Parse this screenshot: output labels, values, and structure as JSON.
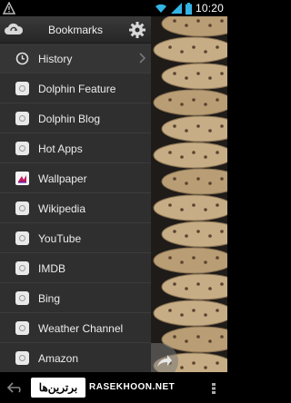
{
  "status_bar": {
    "time": "10:20",
    "icons": [
      "warning-icon",
      "wifi-icon",
      "signal-icon",
      "battery-icon"
    ]
  },
  "drawer": {
    "title": "Bookmarks",
    "header_left_icon": "cloud-sync-icon",
    "header_right_icon": "gear-icon",
    "items": [
      {
        "label": "History",
        "icon": "clock-icon"
      },
      {
        "label": "Dolphin Feature",
        "icon": "bookmark-favicon-icon"
      },
      {
        "label": "Dolphin Blog",
        "icon": "bookmark-favicon-icon"
      },
      {
        "label": "Hot Apps",
        "icon": "bookmark-favicon-icon"
      },
      {
        "label": "Wallpaper",
        "icon": "wallpaper-favicon-icon"
      },
      {
        "label": "Wikipedia",
        "icon": "bookmark-favicon-icon"
      },
      {
        "label": "YouTube",
        "icon": "bookmark-favicon-icon"
      },
      {
        "label": "IMDB",
        "icon": "bookmark-favicon-icon"
      },
      {
        "label": "Bing",
        "icon": "bookmark-favicon-icon"
      },
      {
        "label": "Weather Channel",
        "icon": "bookmark-favicon-icon"
      },
      {
        "label": "Amazon",
        "icon": "bookmark-favicon-icon"
      }
    ]
  },
  "watermark": {
    "logo_text": "برترین‌ها",
    "site_text": "RASEKHOON.NET"
  },
  "colors": {
    "drawer_bg": "#2e2e2e",
    "header_bg": "#262626",
    "text": "#ececec",
    "accent_blue": "#33b5e5"
  }
}
